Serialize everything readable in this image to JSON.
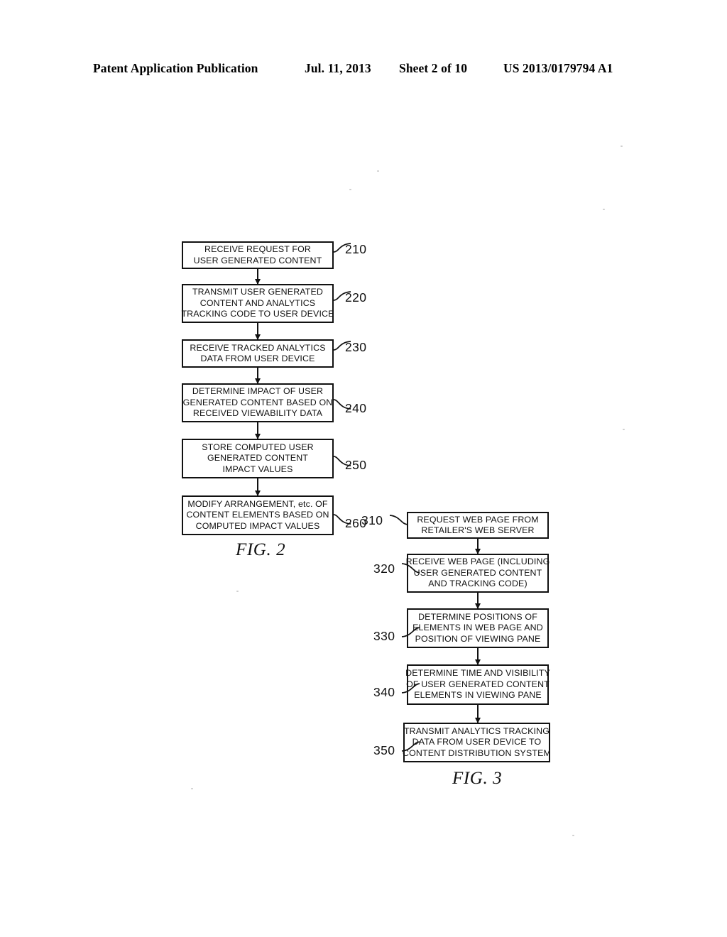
{
  "header": {
    "publication": "Patent Application Publication",
    "date": "Jul. 11, 2013",
    "sheet": "Sheet 2 of 10",
    "doc_number": "US 2013/0179794 A1"
  },
  "figures": [
    {
      "id": "fig-2",
      "caption": "FIG. 2",
      "steps": [
        {
          "ref": "210",
          "lines": [
            "RECEIVE REQUEST FOR",
            "USER GENERATED CONTENT"
          ]
        },
        {
          "ref": "220",
          "lines": [
            "TRANSMIT USER GENERATED",
            "CONTENT AND ANALYTICS",
            "TRACKING CODE TO USER DEVICE"
          ]
        },
        {
          "ref": "230",
          "lines": [
            "RECEIVE TRACKED ANALYTICS",
            "DATA FROM USER DEVICE"
          ]
        },
        {
          "ref": "240",
          "lines": [
            "DETERMINE IMPACT OF USER",
            "GENERATED CONTENT BASED ON",
            "RECEIVED VIEWABILITY DATA"
          ]
        },
        {
          "ref": "250",
          "lines": [
            "STORE COMPUTED USER",
            "GENERATED CONTENT",
            "IMPACT VALUES"
          ]
        },
        {
          "ref": "260",
          "lines": [
            "MODIFY ARRANGEMENT, etc. OF",
            "CONTENT ELEMENTS BASED ON",
            "COMPUTED IMPACT VALUES"
          ]
        }
      ]
    },
    {
      "id": "fig-3",
      "caption": "FIG. 3",
      "steps": [
        {
          "ref": "310",
          "lines": [
            "REQUEST WEB PAGE FROM",
            "RETAILER'S WEB SERVER"
          ]
        },
        {
          "ref": "320",
          "lines": [
            "RECEIVE WEB PAGE (INCLUDING",
            "USER GENERATED CONTENT",
            "AND TRACKING CODE)"
          ]
        },
        {
          "ref": "330",
          "lines": [
            "DETERMINE POSITIONS OF",
            "ELEMENTS IN WEB PAGE AND",
            "POSITION OF VIEWING PANE"
          ]
        },
        {
          "ref": "340",
          "lines": [
            "DETERMINE TIME AND VISIBILITY",
            "OF USER GENERATED CONTENT",
            "ELEMENTS IN VIEWING PANE"
          ]
        },
        {
          "ref": "350",
          "lines": [
            "TRANSMIT ANALYTICS TRACKING",
            "DATA FROM USER DEVICE TO",
            "CONTENT DISTRIBUTION SYSTEM"
          ]
        }
      ]
    }
  ],
  "colors": {
    "ink": "#111111",
    "page": "#ffffff"
  }
}
